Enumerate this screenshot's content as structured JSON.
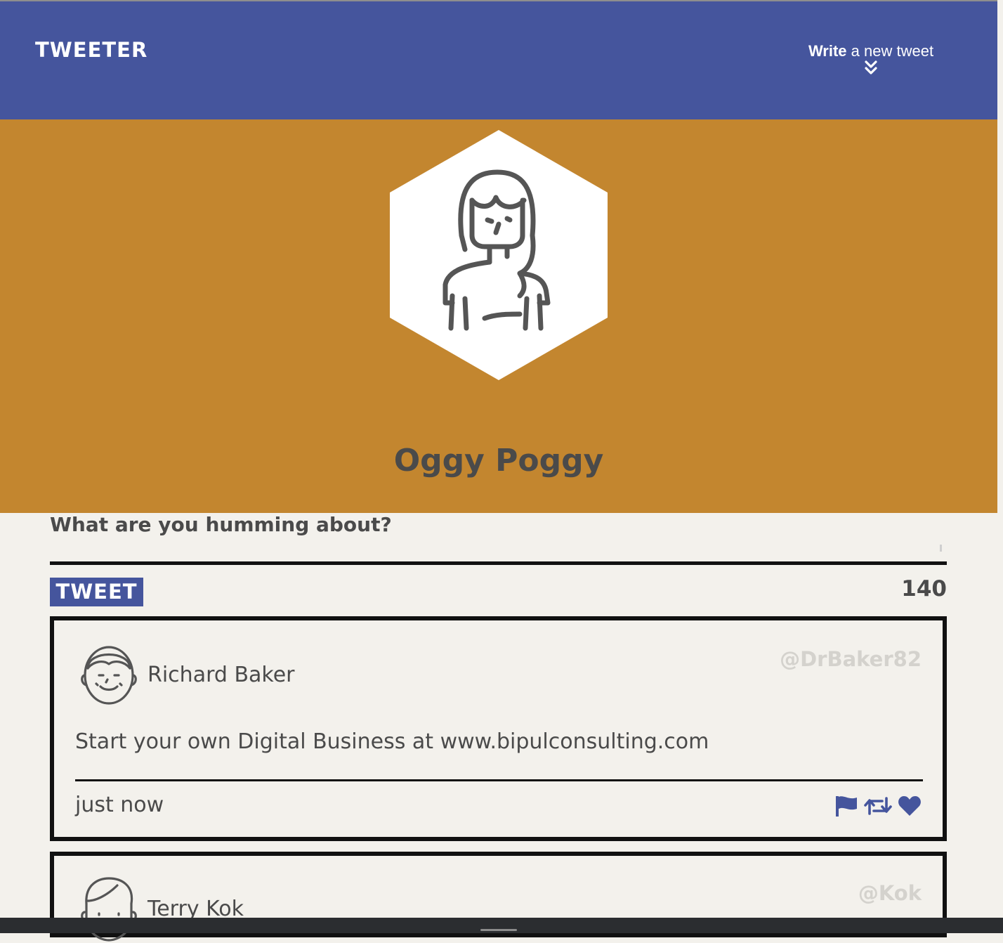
{
  "navbar": {
    "brand": "TWEETER",
    "write_bold": "Write",
    "write_rest": " a new tweet",
    "write_icon": "double-chevron-down-icon",
    "color": "#45559d"
  },
  "profile": {
    "name": "Oggy Poggy",
    "avatar_icon": "woman-avatar-icon",
    "banner_color": "#c3862f"
  },
  "composer": {
    "prompt": "What are you humming about?",
    "input_value": "",
    "button_label": "TWEET",
    "char_count": "140"
  },
  "tweets": [
    {
      "name": "Richard Baker",
      "handle": "@DrBaker82",
      "text": "Start your own Digital Business at www.bipulconsulting.com",
      "time": "just now",
      "avatar_icon": "man-avatar-icon",
      "actions": [
        "flag-icon",
        "retweet-icon",
        "heart-icon"
      ]
    },
    {
      "name": "Terry Kok",
      "handle": "@Kok",
      "avatar_icon": "man-avatar-icon"
    }
  ],
  "colors": {
    "accent": "#45559d",
    "banner": "#c3862f",
    "background": "#f3f1ec",
    "handle": "#d4d2cd"
  }
}
